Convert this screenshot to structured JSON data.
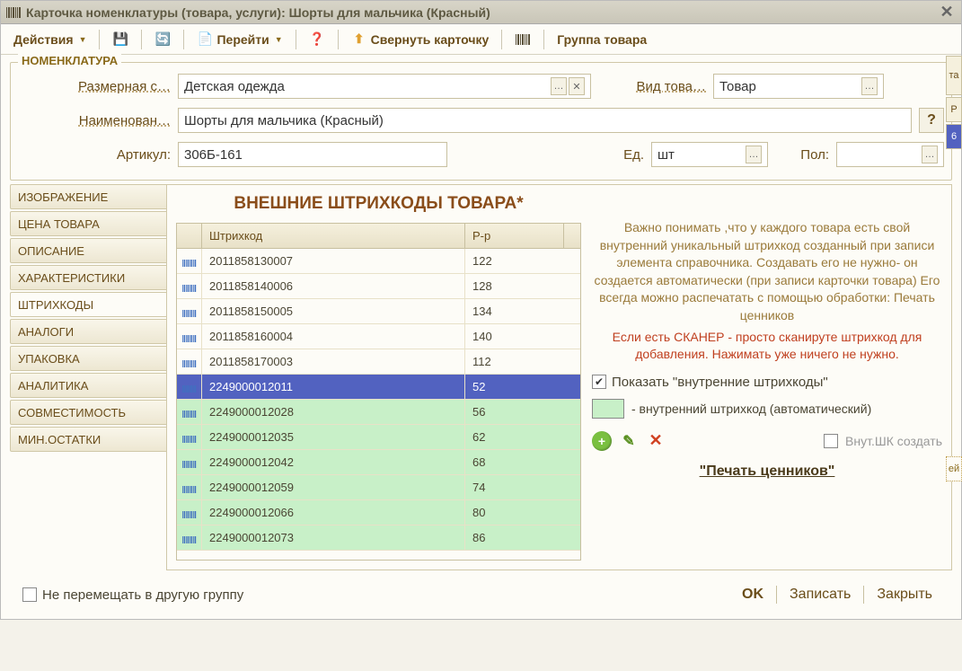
{
  "window": {
    "title": "Карточка номенклатуры (товара, услуги): Шорты для мальчика  (Красный)"
  },
  "toolbar": {
    "actions": "Действия",
    "goto": "Перейти",
    "collapse": "Свернуть карточку",
    "group": "Группа товара"
  },
  "fieldset": {
    "legend": "НОМЕНКЛАТУРА",
    "size_series_label": "Размерная с…",
    "size_series_value": "Детская одежда",
    "kind_label": "Вид това…",
    "kind_value": "Товар",
    "name_label": "Наименован…",
    "name_value": "Шорты для мальчика  (Красный)",
    "article_label": "Артикул:",
    "article_value": "306Б-161",
    "unit_label": "Ед.",
    "unit_value": "шт",
    "gender_label": "Пол:",
    "gender_value": ""
  },
  "tabs": [
    {
      "label": "ИЗОБРАЖЕНИЕ"
    },
    {
      "label": "ЦЕНА ТОВАРА"
    },
    {
      "label": "ОПИСАНИЕ"
    },
    {
      "label": "ХАРАКТЕРИСТИКИ"
    },
    {
      "label": "ШТРИХКОДЫ"
    },
    {
      "label": "АНАЛОГИ"
    },
    {
      "label": "УПАКОВКА"
    },
    {
      "label": "АНАЛИТИКА"
    },
    {
      "label": "СОВМЕСТИМОСТЬ"
    },
    {
      "label": "МИН.ОСТАТКИ"
    }
  ],
  "active_tab": 4,
  "content": {
    "title": "ВНЕШНИЕ ШТРИХКОДЫ ТОВАРА*",
    "col_barcode": "Штрихкод",
    "col_size": "Р-р",
    "rows": [
      {
        "code": "2011858130007",
        "size": "122",
        "internal": false,
        "selected": false
      },
      {
        "code": "2011858140006",
        "size": "128",
        "internal": false,
        "selected": false
      },
      {
        "code": "2011858150005",
        "size": "134",
        "internal": false,
        "selected": false
      },
      {
        "code": "2011858160004",
        "size": "140",
        "internal": false,
        "selected": false
      },
      {
        "code": "2011858170003",
        "size": "112",
        "internal": false,
        "selected": false
      },
      {
        "code": "2249000012011",
        "size": "52",
        "internal": false,
        "selected": true
      },
      {
        "code": "2249000012028",
        "size": "56",
        "internal": true,
        "selected": false
      },
      {
        "code": "2249000012035",
        "size": "62",
        "internal": true,
        "selected": false
      },
      {
        "code": "2249000012042",
        "size": "68",
        "internal": true,
        "selected": false
      },
      {
        "code": "2249000012059",
        "size": "74",
        "internal": true,
        "selected": false
      },
      {
        "code": "2249000012066",
        "size": "80",
        "internal": true,
        "selected": false
      },
      {
        "code": "2249000012073",
        "size": "86",
        "internal": true,
        "selected": false
      }
    ],
    "info1": "Важно понимать ,что у каждого товара есть свой внутренний уникальный штрихкод созданный при записи элемента справочника. Создавать его не нужно- он создается автоматически (при записи карточки товара) Его всегда можно распечатать с помощью обработки: Печать ценников",
    "info2": "Если есть СКАНЕР - просто сканируте штрихкод для добавления. Нажимать уже ничего не нужно.",
    "show_internal_label": "Показать \"внутренние штрихкоды\"",
    "show_internal_checked": true,
    "legend_text": "- внутренний штрихкод (автоматический)",
    "create_internal_label": "Внут.ШК создать",
    "create_internal_checked": false,
    "print_label": "\"Печать ценников\""
  },
  "footer": {
    "dont_move_label": "Не перемещать в другую группу",
    "dont_move_checked": false,
    "ok": "OK",
    "save": "Записать",
    "close": "Закрыть"
  },
  "side": {
    "c1": "та",
    "c2": "Р",
    "c3": "6",
    "c4": "ей"
  }
}
